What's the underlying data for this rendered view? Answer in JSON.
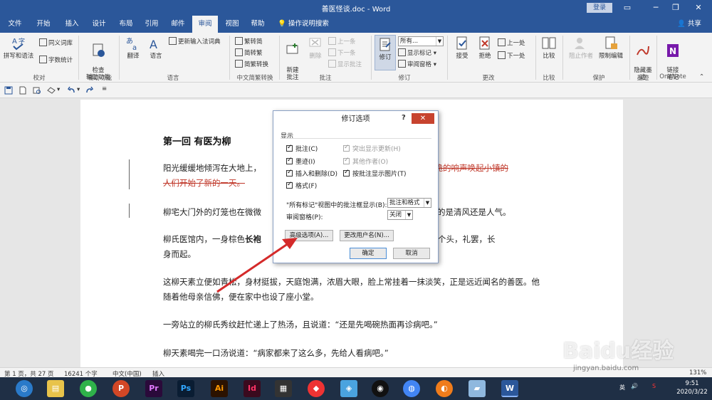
{
  "window": {
    "title": "善医怪谈.doc - Word",
    "login_label": "登录",
    "ribbon_display_icon": "▭",
    "minimize_icon": "─",
    "restore_icon": "❐",
    "close_icon": "✕"
  },
  "menu": {
    "tabs": [
      "文件",
      "开始",
      "插入",
      "设计",
      "布局",
      "引用",
      "邮件",
      "审阅",
      "视图",
      "帮助"
    ],
    "active_tab": "审阅",
    "tell_me": "操作说明搜索",
    "share": "共享"
  },
  "ribbon": {
    "proofing": {
      "spelling": "拼写和语法",
      "thesaurus": "同义词库",
      "wordcount": "字数统计",
      "label": "校对"
    },
    "accessibility": {
      "check": "检查\n辅助功能",
      "label": "辅助功能"
    },
    "language": {
      "translate": "翻译",
      "language": "语言",
      "update_ime": "更新输入法词典",
      "label": "语言"
    },
    "chinese_conv": {
      "to_simplified": "繁转简",
      "to_traditional": "简转繁",
      "conversion": "简繁转换",
      "label": "中文简繁转换"
    },
    "comments": {
      "new": "新建\n批注",
      "delete": "删除",
      "prev": "上一条",
      "next": "下一条",
      "show": "显示批注",
      "label": "批注"
    },
    "tracking": {
      "track": "修订",
      "markup_select": "所有...",
      "show_markup": "显示标记",
      "review_pane": "审阅窗格",
      "label": "修订"
    },
    "changes": {
      "accept": "接受",
      "reject": "拒绝",
      "prev": "上一处",
      "next": "下一处",
      "label": "更改"
    },
    "compare": {
      "compare": "比较",
      "label": "比较"
    },
    "protect": {
      "block": "阻止作者",
      "restrict": "限制编辑",
      "label": "保护"
    },
    "ink": {
      "hide": "隐藏墨\n迹",
      "label": "墨迹"
    },
    "onenote": {
      "linked": "链接\n笔记",
      "label": "OneNote"
    }
  },
  "document": {
    "chapter_title": "第一回  有医为柳",
    "p1_normal": "阳光缓缓地倾泻在大地上，",
    "p1_deleted_a": "清脆的响声唤起小镇的",
    "p1_deleted_b": "人们开始了新的一天。",
    "p2_left": "柳宅大门外的灯笼也在微微",
    "p2_right": "弄它的是清风还是人气。",
    "p3_left": "柳氏医馆内，一身棕色",
    "p3_bold": "长袍",
    "p3_right": "像磕了三个头，礼罢，长",
    "p3_end": "身而起。",
    "p4": "这柳天素立便如青松，身材挺拔，天庭饱满，浓眉大眼，脸上常挂着一抹淡笑，正是远近闻名的善医。他随着他母亲信佛，便在家中也设了座小堂。",
    "p5": "一旁站立的柳氏秀纹赶忙递上了热汤，且说道：“还是先喝碗热面再诊病吧。”",
    "p6": "柳天素喝完一口汤说道：“病家都来了这么多，先给人看病吧。”"
  },
  "dialog": {
    "title": "修订选项",
    "help": "?",
    "close": "✕",
    "section_show": "显示",
    "checks": [
      {
        "label": "批注(C)",
        "checked": true,
        "disabled": false
      },
      {
        "label": "突出显示更新(H)",
        "checked": true,
        "disabled": true
      },
      {
        "label": "墨迹(I)",
        "checked": true,
        "disabled": false
      },
      {
        "label": "其他作者(O)",
        "checked": true,
        "disabled": true
      },
      {
        "label": "插入和删除(D)",
        "checked": true,
        "disabled": false
      },
      {
        "label": "按批注显示图片(T)",
        "checked": true,
        "disabled": false
      },
      {
        "label": "格式(F)",
        "checked": true,
        "disabled": false
      }
    ],
    "balloons_label": "\"所有标记\"视图中的批注框显示(B):",
    "balloons_value": "批注和格式",
    "pane_label": "审阅窗格(P):",
    "pane_value": "关闭",
    "advanced_btn": "高级选项(A)...",
    "username_btn": "更改用户名(N)...",
    "ok_btn": "确定",
    "cancel_btn": "取消"
  },
  "status": {
    "page": "第 1 页，共 27 页",
    "words": "16241 个字",
    "lang": "中文(中国)",
    "mode": "插入",
    "zoom": "131%"
  },
  "taskbar": {
    "clock_time": "9:51",
    "clock_date": "2020/3/22",
    "ime": "英",
    "apps": [
      "Pr",
      "Ps",
      "Ai",
      "Id",
      "W"
    ]
  },
  "watermark": {
    "main": "Baidu经验",
    "sub": "jingyan.baidu.com"
  },
  "colors": {
    "brand": "#2b579a",
    "deleted": "#c0392b",
    "close": "#c7432f"
  }
}
